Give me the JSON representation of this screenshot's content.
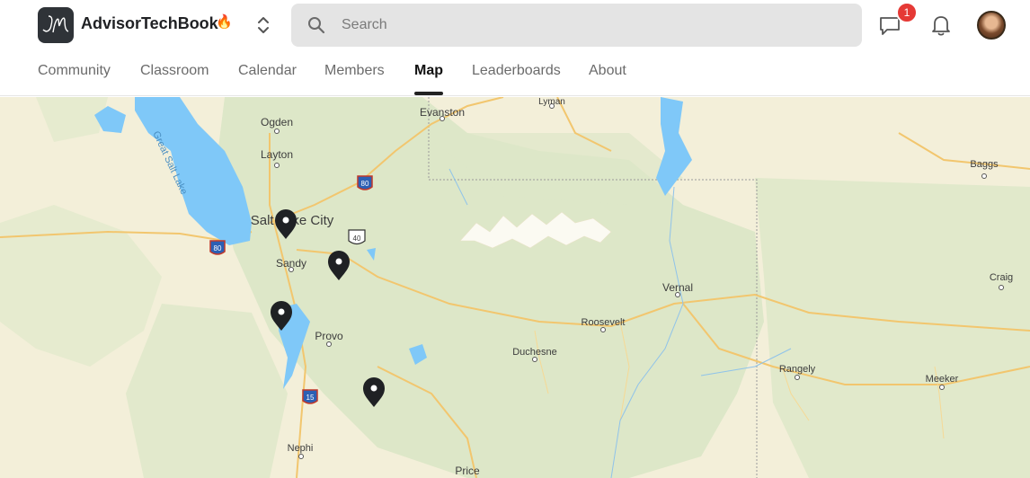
{
  "app": {
    "name": "AdvisorTechBook",
    "logo_text": "JM",
    "name_emoji": "🔥"
  },
  "search": {
    "placeholder": "Search",
    "value": ""
  },
  "notifications": {
    "chat_count": "1"
  },
  "nav": {
    "active": "Map",
    "tabs": [
      {
        "label": "Community"
      },
      {
        "label": "Classroom"
      },
      {
        "label": "Calendar"
      },
      {
        "label": "Members"
      },
      {
        "label": "Map"
      },
      {
        "label": "Leaderboards"
      },
      {
        "label": "About"
      }
    ]
  },
  "map": {
    "cities": [
      {
        "name": "Ogden"
      },
      {
        "name": "Layton"
      },
      {
        "name": "Salt Lake City"
      },
      {
        "name": "Sandy"
      },
      {
        "name": "Provo"
      },
      {
        "name": "Nephi"
      },
      {
        "name": "Price"
      },
      {
        "name": "Evanston"
      },
      {
        "name": "Lyman"
      },
      {
        "name": "Vernal"
      },
      {
        "name": "Roosevelt"
      },
      {
        "name": "Duchesne"
      },
      {
        "name": "Rangely"
      },
      {
        "name": "Meeker"
      },
      {
        "name": "Craig"
      },
      {
        "name": "Baggs"
      }
    ],
    "water_labels": [
      {
        "name": "Great Salt Lake"
      }
    ],
    "highway_shields": [
      {
        "num": "80"
      },
      {
        "num": "80"
      },
      {
        "num": "40"
      },
      {
        "num": "15"
      }
    ],
    "member_pin_count": 4,
    "colors": {
      "land": "#f3efd9",
      "forest": "#dfe8cc",
      "water": "#7fc8f8",
      "road": "#f5c46a",
      "pin": "#1f2124"
    }
  },
  "colors": {
    "badge": "#e53935",
    "active_tab": "#111111",
    "inactive_tab": "#6b6b6b",
    "search_bg": "#e4e4e4"
  }
}
